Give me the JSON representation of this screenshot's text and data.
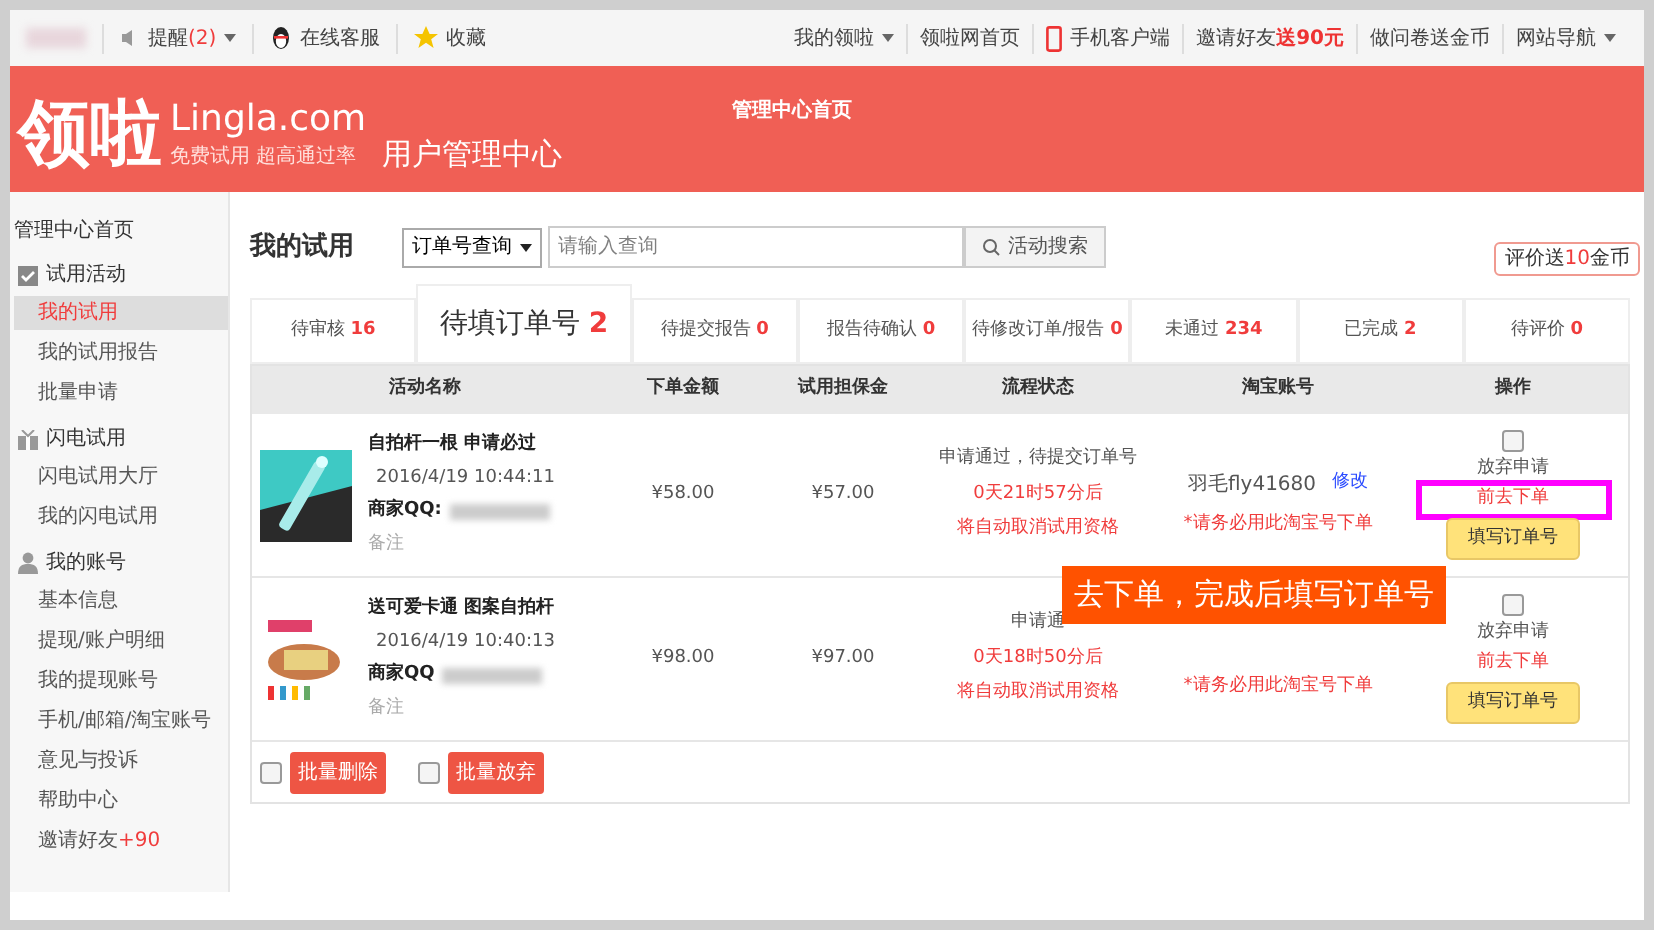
{
  "topbar": {
    "left": [
      {
        "kind": "bell",
        "label": "提醒",
        "count": "(2)"
      },
      {
        "kind": "qq",
        "label": "在线客服"
      },
      {
        "kind": "star",
        "label": "收藏"
      }
    ],
    "right": [
      {
        "kind": "menu",
        "label": "我的领啦"
      },
      {
        "kind": "text",
        "label": "领啦网首页"
      },
      {
        "kind": "phone",
        "label": "手机客户端"
      },
      {
        "kind": "invite",
        "label": "邀请好友",
        "accent": "送90元"
      },
      {
        "kind": "text",
        "label": "做问卷送金币"
      },
      {
        "kind": "menu",
        "label": "网站导航"
      }
    ]
  },
  "header": {
    "logo": "领啦",
    "domain": "Lingla.com",
    "slogan": "免费试用 超高通过率",
    "title": "用户管理中心",
    "nav": "管理中心首页"
  },
  "sidebar": {
    "home": "管理中心首页",
    "groups": [
      {
        "label": "试用活动",
        "items": [
          {
            "label": "我的试用",
            "selected": true
          },
          {
            "label": "我的试用报告",
            "selected": false
          },
          {
            "label": "批量申请",
            "selected": false
          }
        ]
      },
      {
        "label": "闪电试用",
        "items": [
          {
            "label": "闪电试用大厅",
            "selected": false
          },
          {
            "label": "我的闪电试用",
            "selected": false
          }
        ]
      },
      {
        "label": "我的账号",
        "items": [
          {
            "label": "基本信息",
            "selected": false
          },
          {
            "label": "提现/账户明细",
            "selected": false
          },
          {
            "label": "我的提现账号",
            "selected": false
          },
          {
            "label": "手机/邮箱/淘宝账号",
            "selected": false
          },
          {
            "label": "意见与投诉",
            "selected": false
          },
          {
            "label": "帮助中心",
            "selected": false
          },
          {
            "label": "邀请好友",
            "accent": "+90",
            "selected": false
          }
        ]
      }
    ]
  },
  "main": {
    "title": "我的试用",
    "search_type": "订单号查询",
    "search": {
      "placeholder": "请输入查询"
    },
    "search_button": "活动搜索",
    "promo": {
      "before": "评价送",
      "accent": "10",
      "after": "金币"
    },
    "tabs": [
      {
        "label": "待审核",
        "count": "16",
        "selected": false
      },
      {
        "label": "待填订单号",
        "count": "2",
        "selected": true
      },
      {
        "label": "待提交报告",
        "count": "0",
        "selected": false
      },
      {
        "label": "报告待确认",
        "count": "0",
        "selected": false
      },
      {
        "label": "待修改订单/报告",
        "count": "0",
        "selected": false
      },
      {
        "label": "未通过",
        "count": "234",
        "selected": false
      },
      {
        "label": "已完成",
        "count": "2",
        "selected": false
      },
      {
        "label": "待评价",
        "count": "0",
        "selected": false
      }
    ],
    "columns": [
      "活动名称",
      "下单金额",
      "试用担保金",
      "流程状态",
      "淘宝账号",
      "操作"
    ],
    "rows": [
      {
        "name": "自拍杆一根 申请必过",
        "time": "2016/4/19 10:44:11",
        "merchant": "商家QQ:",
        "note": "备注",
        "amount": "¥58.00",
        "deposit": "¥57.00",
        "status": "申请通过，待提交订单号",
        "countdown": "0天21时57分后",
        "cancel": "将自动取消试用资格",
        "account": "羽毛fly41680",
        "edit": "修改",
        "warning": "*请务必用此淘宝号下单",
        "checked": false,
        "abandon": "放弃申请",
        "go": "前去下单",
        "highlighted": true,
        "fill": "填写订单号"
      },
      {
        "name": "送可爱卡通 图案自拍杆",
        "time": "2016/4/19 10:40:13",
        "merchant": "商家QQ",
        "note": "备注",
        "amount": "¥98.00",
        "deposit": "¥97.00",
        "status": "申请通",
        "countdown": "0天18时50分后",
        "cancel": "将自动取消试用资格",
        "warning": "*请务必用此淘宝号下单",
        "checked": false,
        "abandon": "放弃申请",
        "go": "前去下单",
        "highlighted": false,
        "fill": "填写订单号"
      }
    ],
    "bulk": [
      {
        "label": "批量删除",
        "checked": false
      },
      {
        "label": "批量放弃",
        "checked": false
      }
    ],
    "callout": "去下单，完成后填写订单号"
  }
}
